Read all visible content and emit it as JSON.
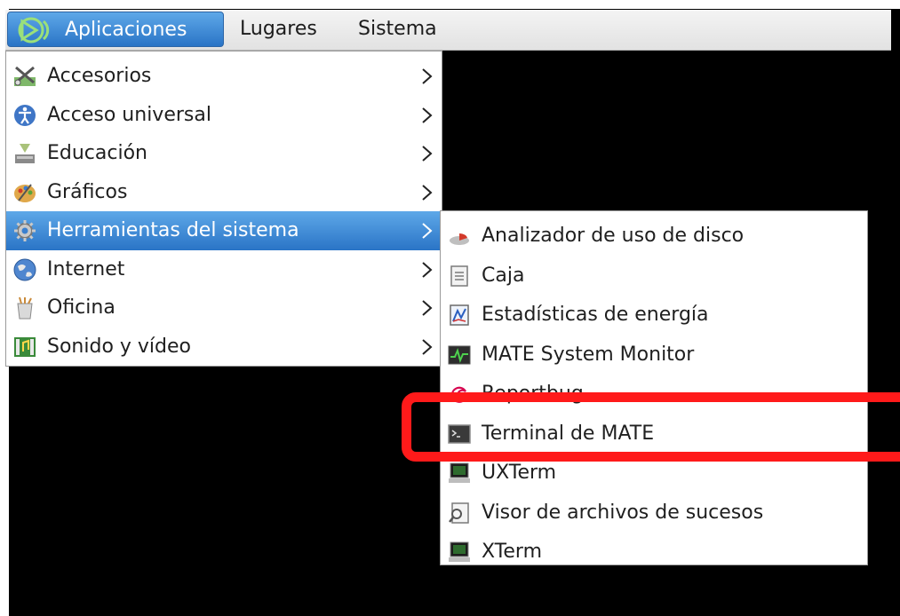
{
  "panel": {
    "applications_label": "Aplicaciones",
    "places_label": "Lugares",
    "system_label": "Sistema"
  },
  "main_menu": {
    "items": [
      {
        "label": "Accesorios",
        "icon": "accessories-icon"
      },
      {
        "label": "Acceso universal",
        "icon": "universal-access-icon"
      },
      {
        "label": "Educación",
        "icon": "education-icon"
      },
      {
        "label": "Gráficos",
        "icon": "graphics-icon"
      },
      {
        "label": "Herramientas del sistema",
        "icon": "gear-icon",
        "active": true
      },
      {
        "label": "Internet",
        "icon": "globe-icon"
      },
      {
        "label": "Oficina",
        "icon": "office-icon"
      },
      {
        "label": "Sonido y vídeo",
        "icon": "multimedia-icon"
      }
    ]
  },
  "sub_menu": {
    "items": [
      {
        "label": "Analizador de uso de disco",
        "icon": "disk-usage-icon"
      },
      {
        "label": "Caja",
        "icon": "file-manager-icon"
      },
      {
        "label": "Estadísticas de energía",
        "icon": "power-statistics-icon"
      },
      {
        "label": "MATE System Monitor",
        "icon": "system-monitor-icon"
      },
      {
        "label": "Reportbug",
        "icon": "debian-swirl-icon"
      },
      {
        "label": "Terminal de MATE",
        "icon": "terminal-icon",
        "highlighted": true
      },
      {
        "label": "UXTerm",
        "icon": "uxterm-icon"
      },
      {
        "label": "Visor de archivos de sucesos",
        "icon": "log-viewer-icon"
      },
      {
        "label": "XTerm",
        "icon": "xterm-icon"
      }
    ]
  },
  "colors": {
    "selection": "#2a74c6",
    "highlight_box": "#ff1a1a",
    "desktop": "#000000"
  }
}
